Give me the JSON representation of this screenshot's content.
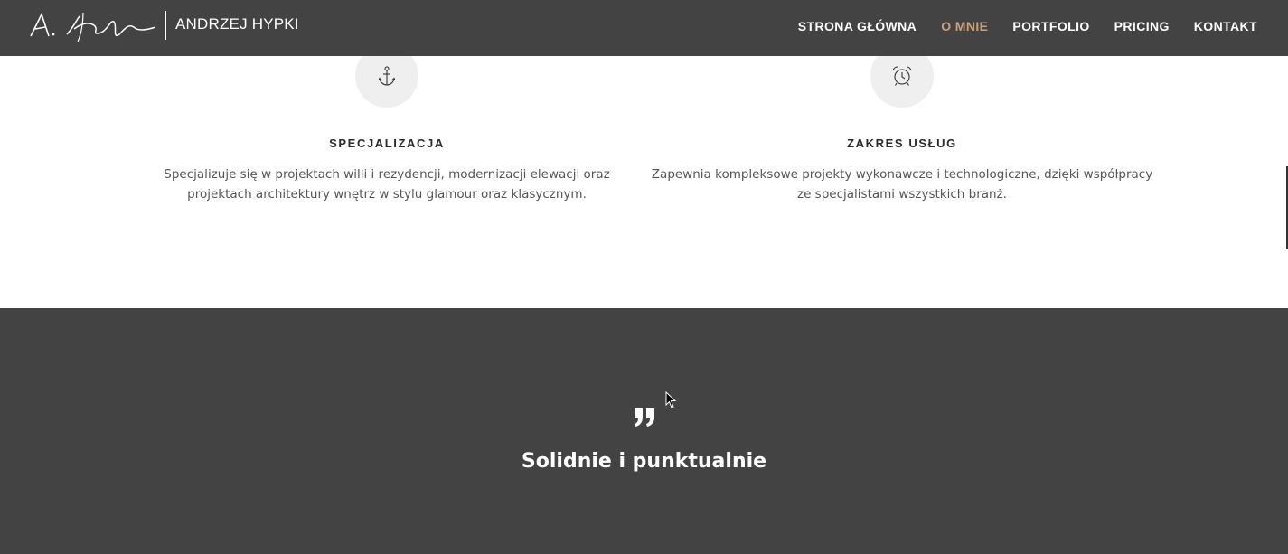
{
  "header": {
    "logo_text": "ANDRZEJ HYPKI",
    "logo_signature": "A. Hypki",
    "nav": [
      {
        "label": "STRONA GŁÓWNA",
        "active": false
      },
      {
        "label": "O MNIE",
        "active": true
      },
      {
        "label": "PORTFOLIO",
        "active": false
      },
      {
        "label": "PRICING",
        "active": false
      },
      {
        "label": "KONTAKT",
        "active": false
      }
    ]
  },
  "features": [
    {
      "icon": "anchor-icon",
      "title": "SPECJALIZACJA",
      "line1": "Specjalizuje się w projektach willi i rezydencji, modernizacji elewacji oraz",
      "line2": "projektach architektury wnętrz w stylu glamour oraz klasycznym."
    },
    {
      "icon": "alarm-clock-icon",
      "title": "ZAKRES USŁUG",
      "line1": "Zapewnia kompleksowe projekty wykonawcze i technologiczne, dzięki współpracy",
      "line2": "ze specjalistami wszystkich branż."
    }
  ],
  "testimonial": {
    "icon": "quote-icon",
    "text": "Solidnie i punktualnie"
  },
  "colors": {
    "header_bg": "#444343",
    "accent": "#c9a27c",
    "icon_circle": "#f0efef",
    "section_dark": "#444343"
  }
}
